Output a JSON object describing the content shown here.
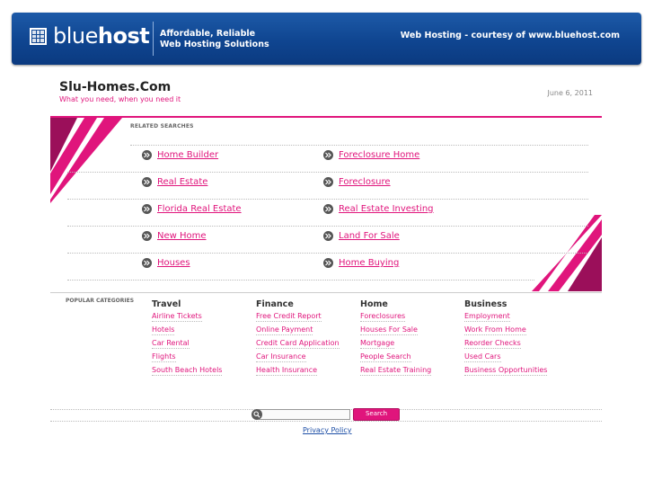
{
  "header": {
    "logo_light": "blue",
    "logo_bold": "host",
    "tagline_line1": "Affordable, Reliable",
    "tagline_line2": "Web Hosting Solutions",
    "courtesy": "Web Hosting - courtesy of www.bluehost.com"
  },
  "site": {
    "title": "Slu-Homes.Com",
    "subtitle": "What you need, when you need it",
    "date": "June 6, 2011"
  },
  "related": {
    "label": "RELATED SEARCHES",
    "left": [
      "Home Builder",
      "Real Estate",
      "Florida Real Estate",
      "New Home",
      "Houses"
    ],
    "right": [
      "Foreclosure Home",
      "Foreclosure",
      "Real Estate Investing",
      "Land For Sale",
      "Home Buying"
    ]
  },
  "popular": {
    "label": "POPULAR CATEGORIES",
    "categories": [
      {
        "title": "Travel",
        "links": [
          "Airline Tickets",
          "Hotels",
          "Car Rental",
          "Flights",
          "South Beach Hotels"
        ]
      },
      {
        "title": "Finance",
        "links": [
          "Free Credit Report",
          "Online Payment",
          "Credit Card Application",
          "Car Insurance",
          "Health Insurance"
        ]
      },
      {
        "title": "Home",
        "links": [
          "Foreclosures",
          "Houses For Sale",
          "Mortgage",
          "People Search",
          "Real Estate Training"
        ]
      },
      {
        "title": "Business",
        "links": [
          "Employment",
          "Work From Home",
          "Reorder Checks",
          "Used Cars",
          "Business Opportunities"
        ]
      }
    ]
  },
  "search": {
    "input_value": "",
    "button_label": "Search"
  },
  "footer": {
    "privacy": "Privacy Policy"
  },
  "colors": {
    "accent": "#e0157c",
    "banner": "#0f4590"
  }
}
